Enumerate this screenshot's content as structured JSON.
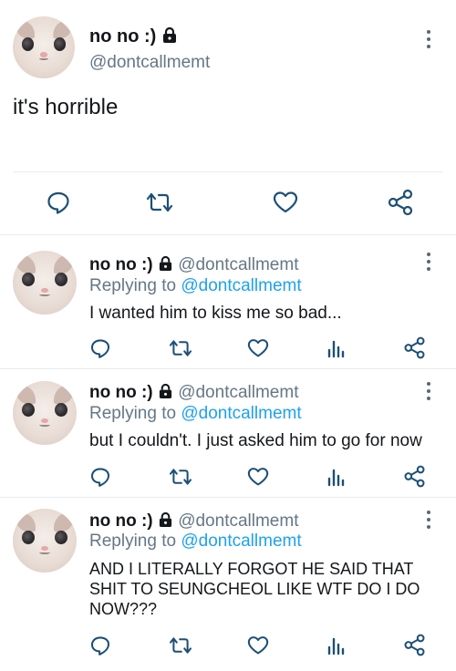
{
  "main_tweet": {
    "name": "no no :)",
    "handle": "@dontcallmemt",
    "text": "it's horrible"
  },
  "replies": [
    {
      "name": "no no :)",
      "handle": "@dontcallmemt",
      "replying_label": "Replying to",
      "replying_handle": "@dontcallmemt",
      "text": "I wanted him to kiss me so bad..."
    },
    {
      "name": "no no :)",
      "handle": "@dontcallmemt",
      "replying_label": "Replying to",
      "replying_handle": "@dontcallmemt",
      "text": "but I couldn't. I just asked him to go for now"
    },
    {
      "name": "no no :)",
      "handle": "@dontcallmemt",
      "replying_label": "Replying to",
      "replying_handle": "@dontcallmemt",
      "text_lines": [
        "AND I LITERALLY FORGOT HE SAID THAT",
        "SHIT TO SEUNGCHEOL LIKE WTF DO I DO",
        "NOW???"
      ]
    }
  ],
  "icons": {
    "reply": "reply-icon",
    "retweet": "retweet-icon",
    "like": "heart-icon",
    "analytics": "analytics-icon",
    "share": "share-icon",
    "more": "more-icon",
    "lock": "lock-icon"
  },
  "colors": {
    "link": "#1da1f2",
    "secondary": "#657786",
    "divider": "#e6ecf0"
  }
}
